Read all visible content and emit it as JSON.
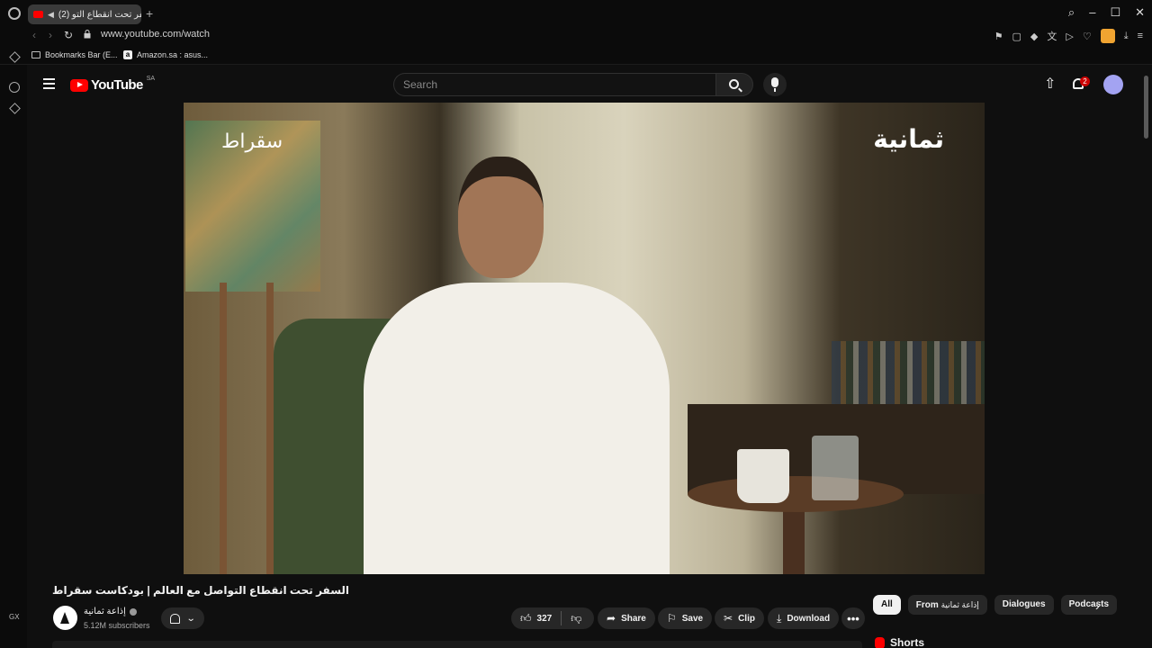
{
  "browser": {
    "tab_title": "(2) السفر تحت انقطاع التو...",
    "url": "www.youtube.com/watch",
    "bookmarks": [
      {
        "label": "Bookmarks Bar (E..."
      },
      {
        "label": "Amazon.sa : asus..."
      }
    ],
    "sidebar_bottom_label": "GX"
  },
  "youtube": {
    "logo_text": "YouTube",
    "country_code": "SA",
    "search_placeholder": "Search",
    "notification_count": "2"
  },
  "video": {
    "overlay_left": "سقراط",
    "overlay_right": "ثمانية",
    "title": "السفر تحت انقطاع التواصل مع العالم | بودكاست سقراط"
  },
  "channel": {
    "name": "إذاعة ثمانية",
    "subscribers": "5.12M subscribers"
  },
  "actions": {
    "likes": "327",
    "share": "Share",
    "save": "Save",
    "clip": "Clip",
    "download": "Download"
  },
  "chips": {
    "all": "All",
    "from": "From",
    "from_channel": "إذاعة ثمانية",
    "dialogues": "Dialogues",
    "podcasts": "Podcasts"
  },
  "sidebar_section": "Shorts"
}
